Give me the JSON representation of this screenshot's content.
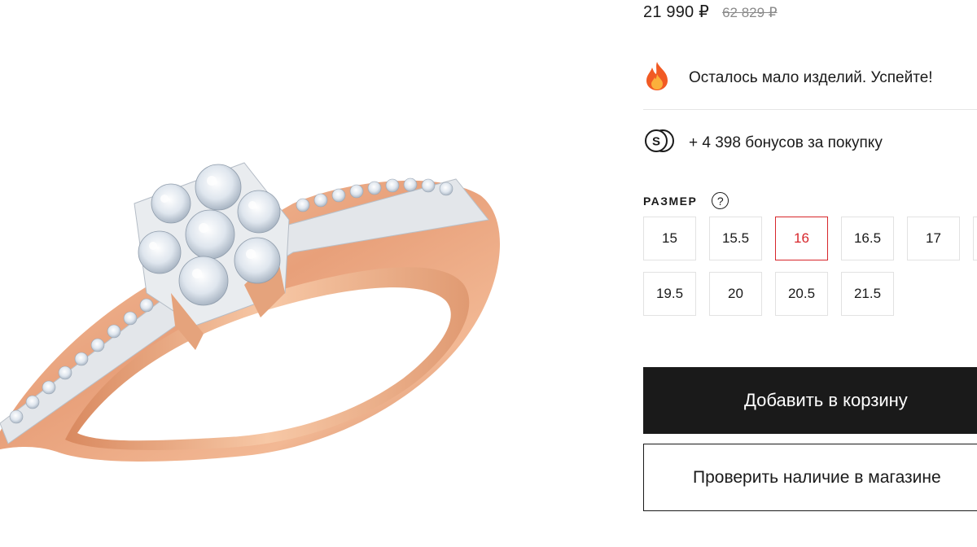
{
  "price": {
    "current": "21 990 ₽",
    "old": "62 829 ₽"
  },
  "urgency": {
    "icon": "fire-icon",
    "text": "Осталось мало изделий. Успейте!"
  },
  "bonus": {
    "icon": "bonus-coin-icon",
    "text": "+ 4 398 бонусов за покупку"
  },
  "size": {
    "label": "РАЗМЕР",
    "help_icon_text": "?",
    "selected": "16",
    "options": [
      "15",
      "15.5",
      "16",
      "16.5",
      "17",
      "19.5",
      "20",
      "20.5",
      "21.5"
    ]
  },
  "actions": {
    "add_to_cart": "Добавить в корзину",
    "check_store": "Проверить наличие в магазине"
  },
  "colors": {
    "text": "#1a1a1a",
    "accent_selected": "#d7262b",
    "button_dark": "#1a1a1a",
    "old_price": "#8a8a8a",
    "rose_gold": "#e8a882"
  },
  "product_image": {
    "icon": "diamond-ring-image"
  }
}
